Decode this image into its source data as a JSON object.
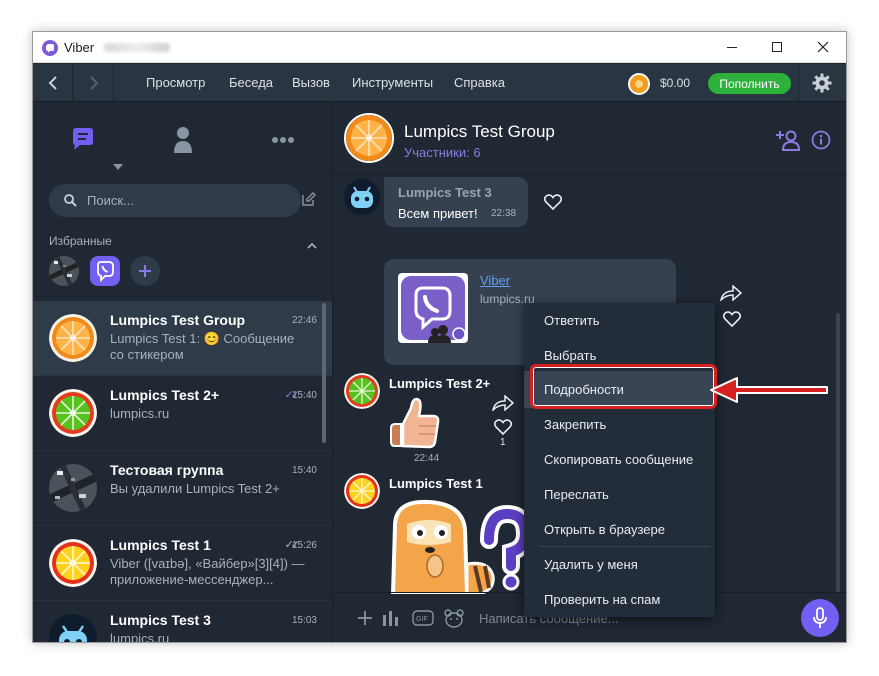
{
  "window": {
    "title": "Viber"
  },
  "menubar": {
    "items": [
      "Просмотр",
      "Беседа",
      "Вызов",
      "Инструменты",
      "Справка"
    ],
    "balance": "$0.00",
    "topup_label": "Пополнить"
  },
  "sidebar": {
    "search_placeholder": "Поиск...",
    "favorites_label": "Избранные",
    "chats": [
      {
        "name": "Lumpics Test Group",
        "preview": "Lumpics Test 1: 😊 Сообщение со стикером",
        "time": "22:46"
      },
      {
        "name": "Lumpics Test 2+",
        "preview": "lumpics.ru",
        "time": "15:40",
        "ticks": "✓✓"
      },
      {
        "name": "Тестовая группа",
        "preview": "Вы удалили Lumpics Test 2+",
        "time": "15:40"
      },
      {
        "name": "Lumpics Test 1",
        "preview": "Viber ([vaɪbə], «Вайбер»[3][4]) — приложение-мессенджер...",
        "time": "15:26",
        "ticks": "✓✓"
      },
      {
        "name": "Lumpics Test 3",
        "preview": "lumpics.ru",
        "time": "15:03"
      }
    ]
  },
  "chat": {
    "title": "Lumpics Test Group",
    "subtitle": "Участники: 6",
    "messages": [
      {
        "sender": "Lumpics Test 3",
        "text": "Всем привет!",
        "time": "22:38"
      },
      {
        "link_title": "Viber",
        "link_url": "lumpics.ru"
      },
      {
        "sender": "Lumpics Test 2+",
        "time": "22:44",
        "likes": "1"
      },
      {
        "sender": "Lumpics Test 1"
      }
    ],
    "composer_placeholder": "Написать сообщение..."
  },
  "context_menu": {
    "items": [
      "Ответить",
      "Выбрать",
      "Подробности",
      "Закрепить",
      "Скопировать сообщение",
      "Переслать",
      "Открыть в браузере",
      "Удалить у меня",
      "Проверить на спам"
    ],
    "highlighted": "Подробности"
  },
  "colors": {
    "accent": "#7360f2",
    "topup": "#2db13b",
    "annotation": "#d72020",
    "background": "#1f2833"
  }
}
